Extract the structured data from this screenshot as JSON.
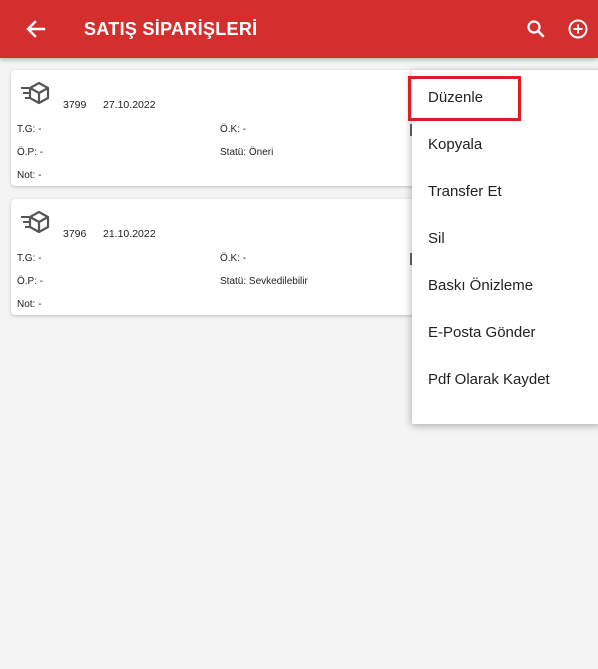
{
  "colors": {
    "appbar": "#d32f2f",
    "highlight": "#e01b24",
    "background": "#f4f4f4",
    "card": "#ffffff"
  },
  "header": {
    "title": "SATIŞ SİPARİŞLERİ",
    "back_icon": "arrow-left-icon",
    "search_icon": "search-icon",
    "add_icon": "add-circle-icon"
  },
  "orders": [
    {
      "icon": "order-box-icon",
      "number": "3799",
      "date": "27.10.2022",
      "tg": "T.G: -",
      "ok": "Ö.K: -",
      "op": "Ö.P: -",
      "status": "Statü: Öneri",
      "note": "Not: -"
    },
    {
      "icon": "order-box-icon",
      "number": "3796",
      "date": "21.10.2022",
      "tg": "T.G: -",
      "ok": "Ö.K: -",
      "op": "Ö.P: -",
      "status": "Statü: Sevkedilebilir",
      "note": "Not: -"
    }
  ],
  "menu": {
    "items": [
      "Düzenle",
      "Kopyala",
      "Transfer Et",
      "Sil",
      "Baskı Önizleme",
      "E-Posta Gönder",
      "Pdf Olarak Kaydet"
    ],
    "highlighted_item": "Düzenle"
  }
}
